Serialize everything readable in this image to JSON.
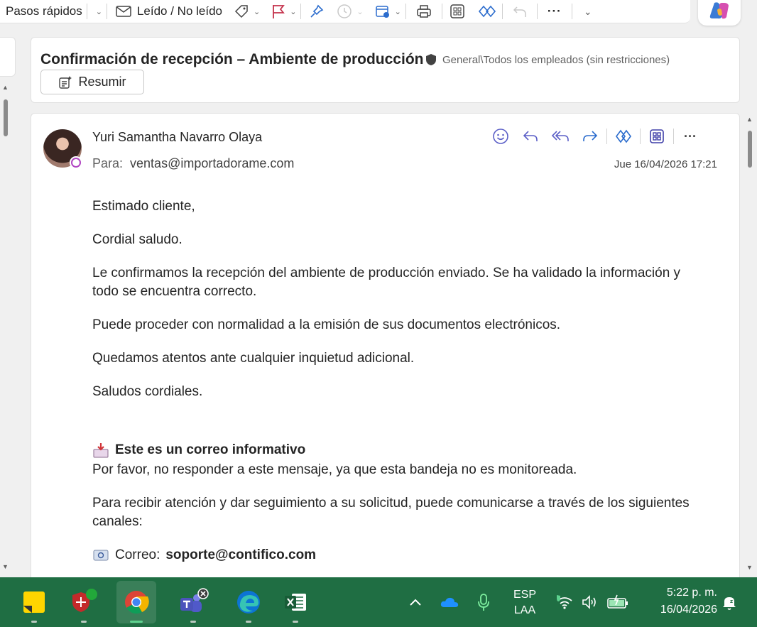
{
  "ribbon": {
    "quick_steps": "Pasos rápidos",
    "read_unread": "Leído / No leído"
  },
  "message": {
    "subject": "Confirmación de recepción – Ambiente de producción",
    "classification": "General\\Todos los empleados (sin restricciones)",
    "summarize_label": "Resumir",
    "sender": "Yuri Samantha Navarro Olaya",
    "to_label": "Para:",
    "to_address": "ventas@importadorame.com",
    "date": "Jue 16/04/2026 17:21",
    "body": {
      "greeting": "Estimado cliente,",
      "salute": "Cordial saludo.",
      "p1": "Le confirmamos la recepción del ambiente de producción enviado. Se ha validado la información y todo se encuentra correcto.",
      "p2": "Puede proceder con normalidad a la emisión de sus documentos electrónicos.",
      "p3": "Quedamos atentos ante cualquier inquietud adicional.",
      "closing": "Saludos cordiales.",
      "info_title": "Este es un correo informativo",
      "info_text": "Por favor, no responder a este mensaje, ya que esta bandeja no es monitoreada.",
      "channels_text": "Para recibir atención y dar seguimiento a su solicitud, puede comunicarse a través de los siguientes canales:",
      "email_label": "Correo:",
      "email_value": "soporte@contifico.com"
    }
  },
  "taskbar": {
    "lang_line1": "ESP",
    "lang_line2": "LAA",
    "time": "5:22 p. m.",
    "date": "16/04/2026"
  },
  "colors": {
    "accent": "#5b5fc7",
    "taskbar": "#1f6e43",
    "reaction_icons": "#5b5fc7"
  }
}
